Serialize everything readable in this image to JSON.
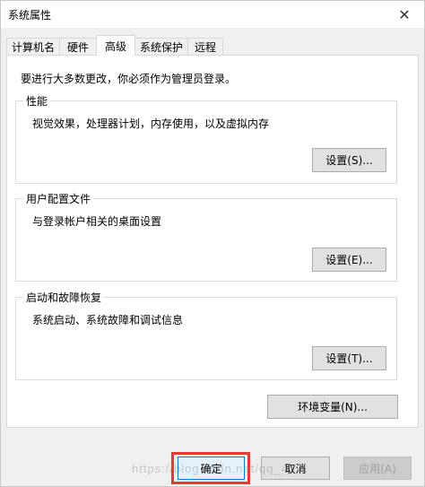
{
  "window": {
    "title": "系统属性",
    "close_glyph": "✕"
  },
  "tabs": [
    {
      "label": "计算机名"
    },
    {
      "label": "硬件"
    },
    {
      "label": "高级"
    },
    {
      "label": "系统保护"
    },
    {
      "label": "远程"
    }
  ],
  "notice": "要进行大多数更改，你必须作为管理员登录。",
  "groups": {
    "performance": {
      "title": "性能",
      "desc": "视觉效果，处理器计划，内存使用，以及虚拟内存",
      "button": "设置(S)..."
    },
    "user_profiles": {
      "title": "用户配置文件",
      "desc": "与登录帐户相关的桌面设置",
      "button": "设置(E)..."
    },
    "startup_recovery": {
      "title": "启动和故障恢复",
      "desc": "系统启动、系统故障和调试信息",
      "button": "设置(T)..."
    }
  },
  "env_button": "环境变量(N)...",
  "footer": {
    "ok": "确定",
    "cancel": "取消",
    "apply": "应用(A)"
  },
  "watermark": "https://blog.csdn.net/qq_41..."
}
